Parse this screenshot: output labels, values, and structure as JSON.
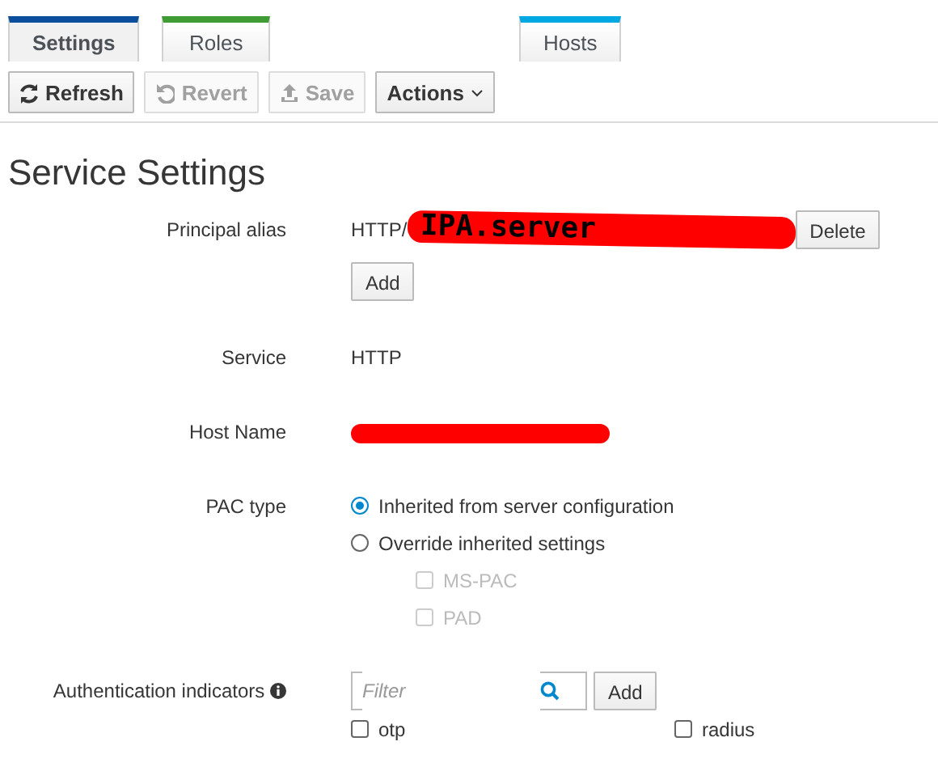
{
  "tabs": [
    {
      "label": "Settings",
      "selected": true,
      "color": "#0b4f9c"
    },
    {
      "label": "Roles",
      "selected": false,
      "color": "#3f9c35"
    },
    {
      "label": "Hosts",
      "selected": false,
      "color": "#00a8e1"
    }
  ],
  "toolbar": [
    {
      "label": "Refresh",
      "kind": "refresh",
      "disabled": false
    },
    {
      "label": "Revert",
      "kind": "revert",
      "disabled": true
    },
    {
      "label": "Save",
      "kind": "save",
      "disabled": true
    },
    {
      "label": "Actions",
      "kind": "dropdown",
      "disabled": false
    }
  ],
  "section_title": "Service Settings",
  "fields": [
    {
      "kind": "multivalue",
      "label": "Principal alias",
      "values": [
        {
          "prefix": "HTTP/",
          "scribble": "IPA.server",
          "button": "Delete"
        }
      ],
      "add_button": "Add"
    },
    {
      "kind": "text",
      "label": "Service",
      "value": "HTTP"
    },
    {
      "kind": "redacted",
      "label": "Host Name"
    },
    {
      "kind": "radio",
      "label": "PAC type",
      "options": [
        {
          "label": "Inherited from server configuration",
          "selected": true
        },
        {
          "label": "Override inherited settings",
          "selected": false
        }
      ],
      "checkboxes": [
        {
          "label": "MS-PAC",
          "checked": false,
          "disabled": true
        },
        {
          "label": "PAD",
          "checked": false,
          "disabled": true
        }
      ]
    },
    {
      "kind": "indicators",
      "label": "Authentication indicators",
      "filter": {
        "placeholder": "Filter"
      },
      "add_button": "Add",
      "checkboxes": [
        {
          "label": "otp",
          "checked": false,
          "disabled": false
        },
        {
          "label": "radius",
          "checked": false,
          "disabled": false
        }
      ]
    }
  ]
}
